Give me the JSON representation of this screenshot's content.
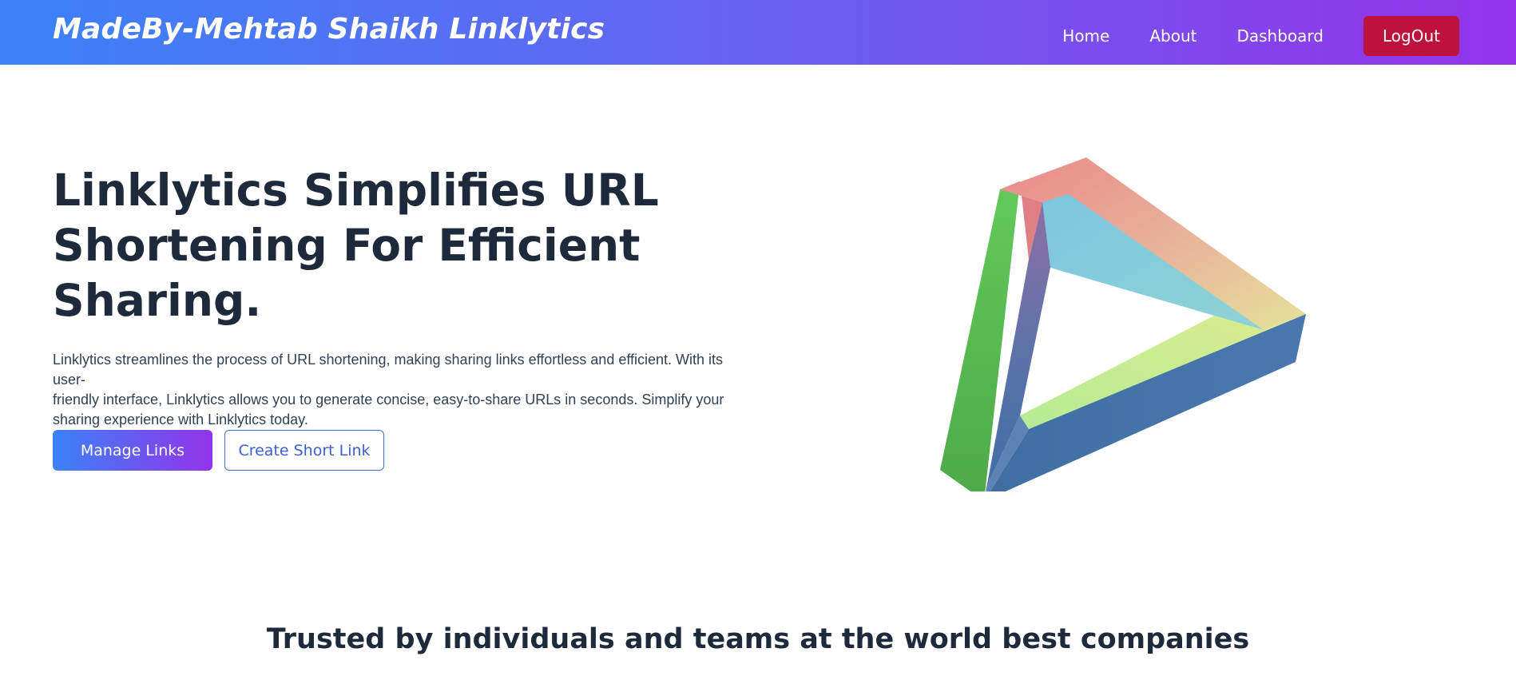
{
  "header": {
    "brand": "MadeBy-Mehtab Shaikh Linklytics",
    "nav": [
      {
        "label": "Home"
      },
      {
        "label": "About"
      },
      {
        "label": "Dashboard"
      }
    ],
    "logout_label": "LogOut"
  },
  "hero": {
    "title_lines": [
      "Linklytics Simplifies URL",
      "Shortening For Efficient",
      "Sharing."
    ],
    "description_lines": [
      "Linklytics streamlines the process of URL shortening, making sharing links effortless and efficient. With its user-",
      "friendly interface, Linklytics allows you to generate concise, easy-to-share URLs in seconds. Simplify your",
      "sharing experience with Linklytics today."
    ],
    "primary_button": "Manage Links",
    "secondary_button": "Create Short Link",
    "graphic_icon": "impossible-triangle-illustration"
  },
  "trusted": {
    "title": "Trusted by individuals and teams at the world best companies"
  },
  "colors": {
    "nav_gradient_start": "#3b82f6",
    "nav_gradient_end": "#9333ea",
    "logout": "#be123c",
    "heading": "#1e293b"
  }
}
